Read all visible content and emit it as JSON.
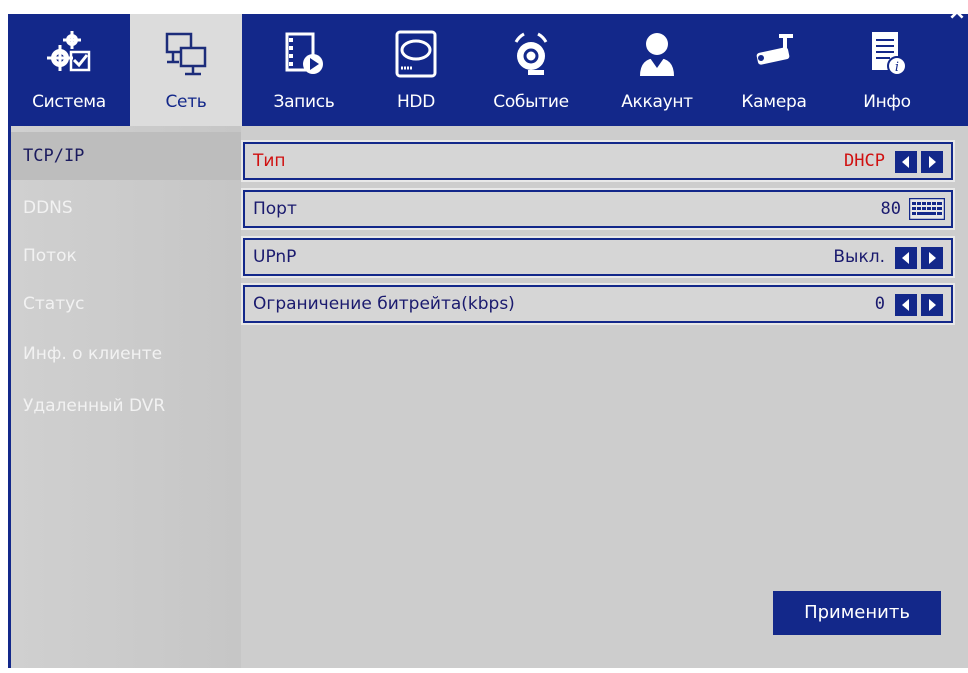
{
  "window": {
    "close_label": "×"
  },
  "tabs": [
    {
      "label": "Система",
      "icon": "gears-checkbox-icon",
      "active": false
    },
    {
      "label": "Сеть",
      "icon": "network-monitors-icon",
      "active": true
    },
    {
      "label": "Запись",
      "icon": "film-play-icon",
      "active": false
    },
    {
      "label": "HDD",
      "icon": "hard-drive-icon",
      "active": false
    },
    {
      "label": "Событие",
      "icon": "alarm-bell-icon",
      "active": false
    },
    {
      "label": "Аккаунт",
      "icon": "user-account-icon",
      "active": false
    },
    {
      "label": "Камера",
      "icon": "cctv-camera-icon",
      "active": false
    },
    {
      "label": "Инфо",
      "icon": "document-info-icon",
      "active": false
    }
  ],
  "sidebar": {
    "items": [
      {
        "label": "TCP/IP",
        "active": true
      },
      {
        "label": "DDNS",
        "active": false
      },
      {
        "label": "Поток",
        "active": false
      },
      {
        "label": "Статус",
        "active": false
      },
      {
        "label": "Инф. о клиенте",
        "active": false
      },
      {
        "label": "Удаленный DVR",
        "active": false
      }
    ]
  },
  "settings": [
    {
      "label": "Тип",
      "value": "DHCP",
      "control": "arrows",
      "highlight": true
    },
    {
      "label": "Порт",
      "value": "80",
      "control": "keyboard",
      "highlight": false
    },
    {
      "label": "UPnP",
      "value": "Выкл.",
      "control": "arrows",
      "highlight": false
    },
    {
      "label": "Ограничение битрейта(kbps)",
      "value": "0",
      "control": "arrows",
      "highlight": false
    }
  ],
  "apply_label": "Применить",
  "colors": {
    "accent": "#13288a",
    "highlight_text": "#d01010",
    "panel": "#cdcdcd"
  }
}
